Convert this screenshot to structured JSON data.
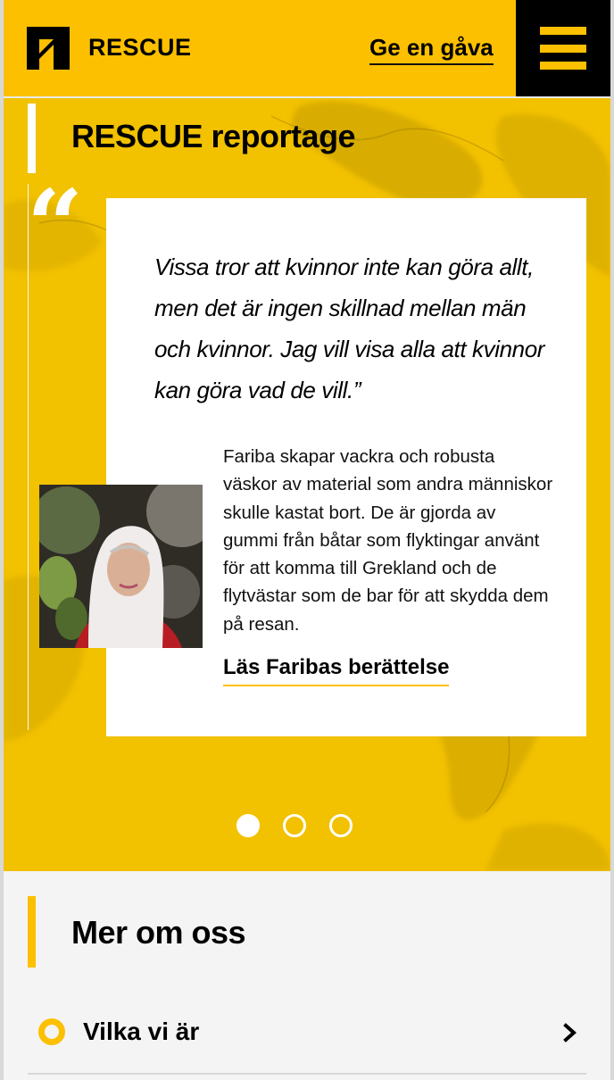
{
  "header": {
    "brand": "RESCUE",
    "donate_label": "Ge en gåva",
    "colors": {
      "accent": "#fcc000",
      "dark": "#000000"
    }
  },
  "hero": {
    "title": "RESCUE reportage",
    "quote_mark": "“",
    "quote": "Vissa tror att kvinnor inte kan göra allt, men det är ingen skillnad mellan män och kvinnor. Jag vill visa alla att kvinnor kan göra vad de vill.”",
    "story": "Fariba skapar vackra och robusta väskor av material som andra människor skulle kastat bort. De är gjorda av gummi från båtar som flyktingar använt för att komma till Grekland och de flytvästar som de bar för att skydda dem på resan.",
    "read_more": "Läs Faribas berättelse",
    "carousel": {
      "count": 3,
      "active_index": 0
    }
  },
  "more": {
    "title": "Mer om oss",
    "items": [
      {
        "label": "Vilka vi är"
      }
    ]
  }
}
